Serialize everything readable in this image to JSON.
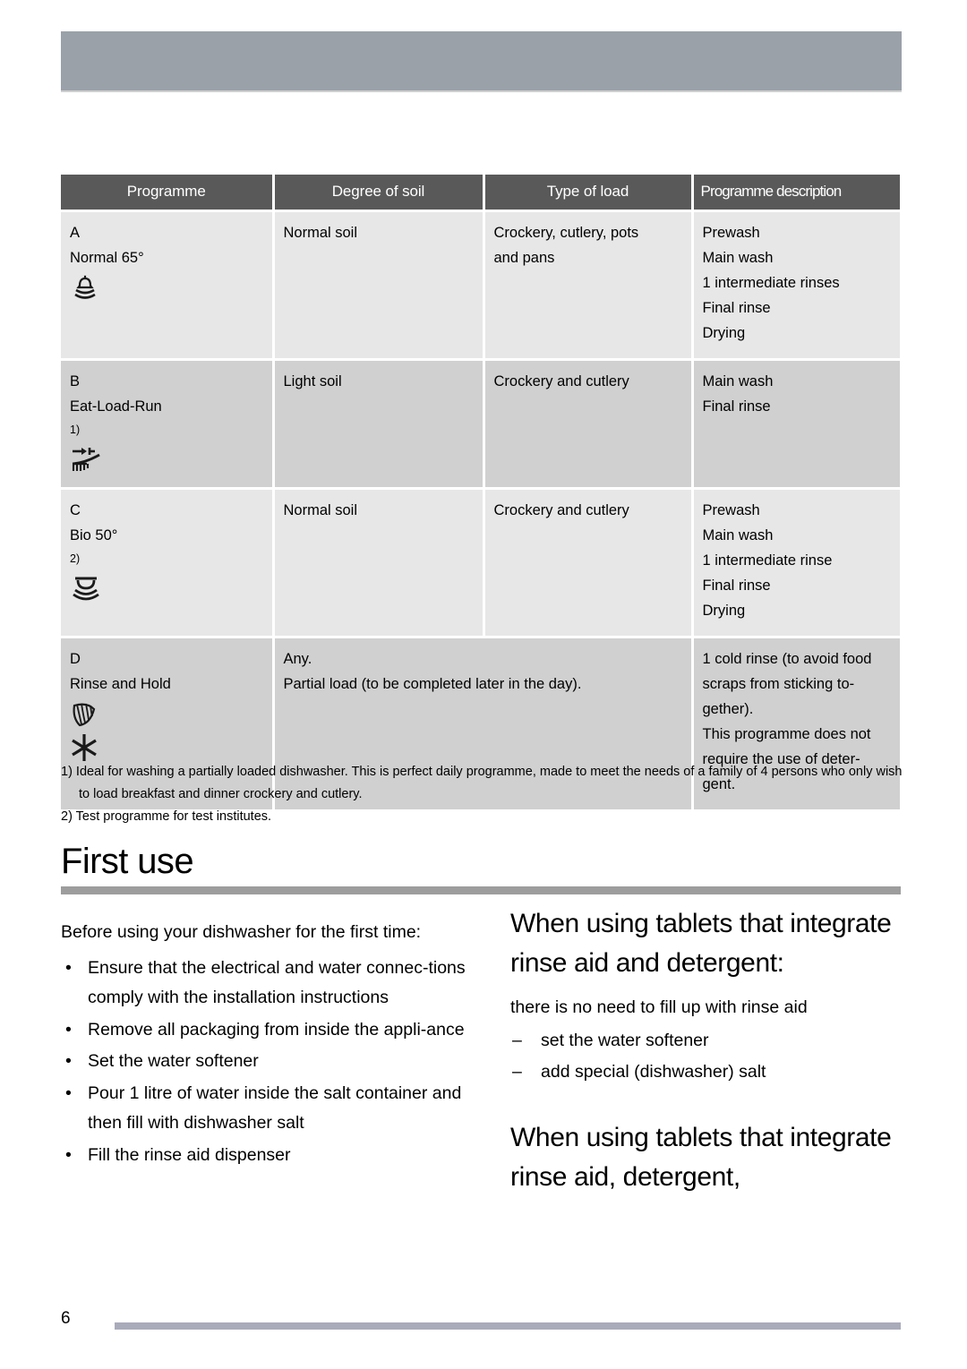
{
  "header": {
    "bar_color": "#9aa1a9"
  },
  "table": {
    "columns": [
      "Programme",
      "Degree of soil",
      "Type of load",
      "Programme description"
    ],
    "rows": [
      {
        "shade": "light",
        "programme": {
          "letter": "A",
          "name": "Normal 65°",
          "footnote": "",
          "icon": "plates-spray-icon"
        },
        "degree_of_soil": [
          "Normal soil"
        ],
        "type_of_load": [
          "Crockery, cutlery, pots",
          "and pans"
        ],
        "description": [
          "Prewash",
          "Main wash",
          "1 intermediate rinses",
          "Final rinse",
          "Drying"
        ]
      },
      {
        "shade": "dark",
        "programme": {
          "letter": "B",
          "name": "Eat-Load-Run",
          "footnote": "1)",
          "icon": "quick-wash-arrow-icon"
        },
        "degree_of_soil": [
          "Light soil"
        ],
        "type_of_load": [
          "Crockery and cutlery"
        ],
        "description": [
          "Main wash",
          "Final rinse"
        ]
      },
      {
        "shade": "light",
        "programme": {
          "letter": "C",
          "name": "Bio 50°",
          "footnote": "2)",
          "icon": "bio-plates-icon"
        },
        "degree_of_soil": [
          "Normal soil"
        ],
        "type_of_load": [
          "Crockery and cutlery"
        ],
        "description": [
          "Prewash",
          "Main wash",
          "1 intermediate rinse",
          "Final rinse",
          "Drying"
        ]
      },
      {
        "shade": "dark",
        "merged_middle": true,
        "programme": {
          "letter": "D",
          "name": "Rinse and Hold",
          "footnote": "",
          "icon": "rinse-hold-icon"
        },
        "merged_text": [
          "Any.",
          "Partial load (to be completed later in the day)."
        ],
        "description": [
          "1 cold rinse (to avoid food",
          "scraps from sticking to-",
          "gether).",
          "This programme does not",
          "require the use of deter-",
          "gent."
        ]
      }
    ]
  },
  "footnotes": [
    "1) Ideal for washing a partially loaded dishwasher. This is perfect daily programme, made to meet the needs of a family of 4 persons who only wish to load breakfast and dinner crockery and cutlery.",
    "2) Test programme for test institutes."
  ],
  "section": {
    "title": "First use"
  },
  "left_column": {
    "lead": "Before using your dishwasher for the first time:",
    "bullet_char": "•",
    "bullets": [
      "Ensure that the electrical and water connec-tions comply with the installation instructions",
      "Remove all packaging from inside the appli-ance",
      "Set the water softener",
      "Pour 1 litre of water inside the salt container and then fill with dishwasher salt",
      "Fill the rinse aid dispenser"
    ]
  },
  "right_column": {
    "heading_1": "When using tablets that integrate rinse aid and detergent:",
    "body_1": "there is no need to fill up with rinse aid",
    "dash_char": "–",
    "dashes_1": [
      "set the water softener",
      "add special (dishwasher) salt"
    ],
    "heading_2": "When using tablets that integrate rinse aid, detergent,"
  },
  "footer": {
    "page_number": "6",
    "rule_color": "#a9abbb"
  }
}
